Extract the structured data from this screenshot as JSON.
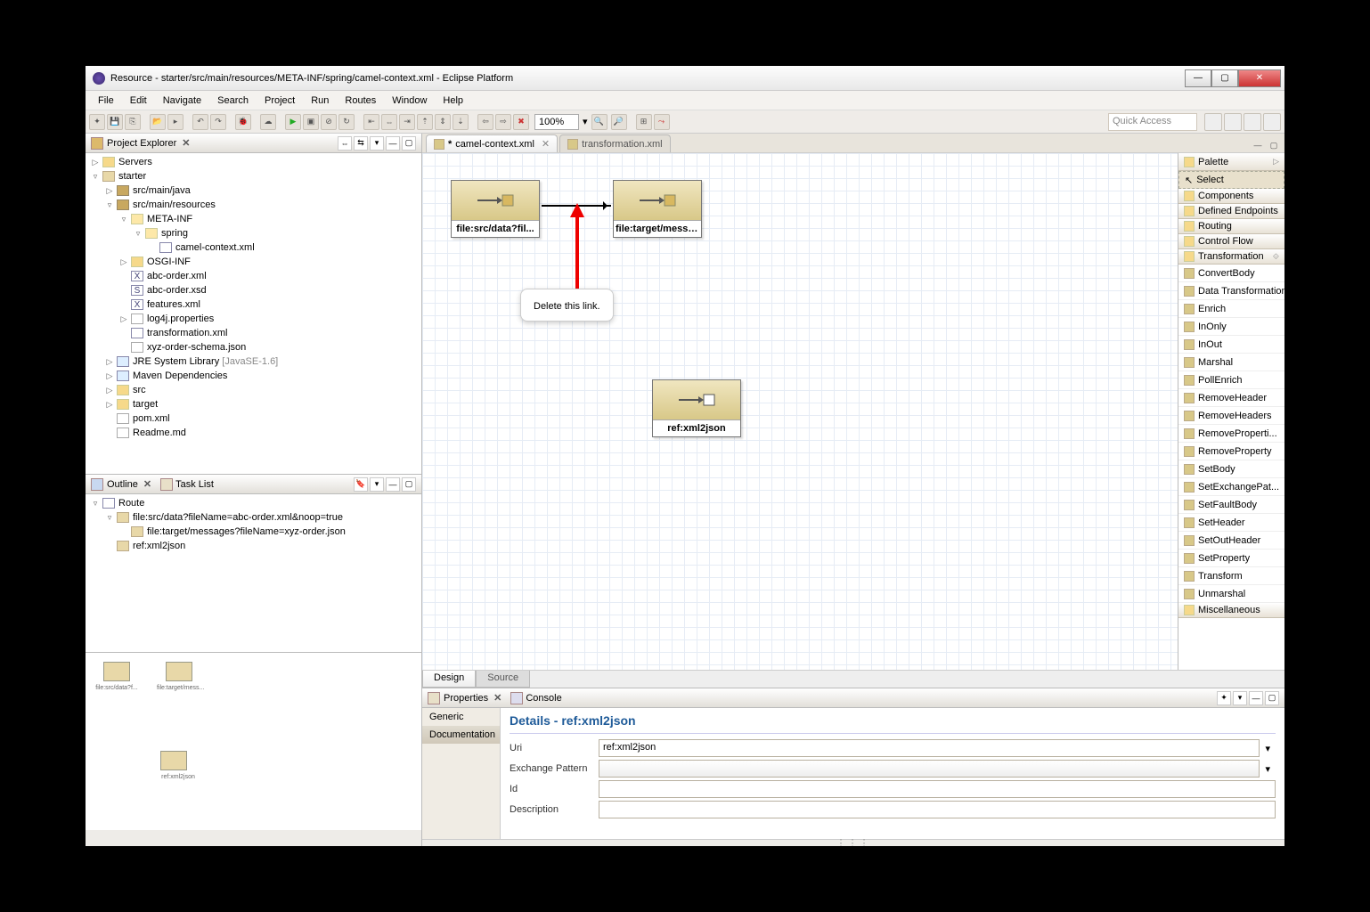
{
  "window": {
    "title": "Resource - starter/src/main/resources/META-INF/spring/camel-context.xml - Eclipse Platform"
  },
  "menus": [
    "File",
    "Edit",
    "Navigate",
    "Search",
    "Project",
    "Run",
    "Routes",
    "Window",
    "Help"
  ],
  "toolbar": {
    "zoom": "100%",
    "quick_access": "Quick Access"
  },
  "projectExplorer": {
    "title": "Project Explorer",
    "tree": {
      "servers": "Servers",
      "starter": "starter",
      "src_java": "src/main/java",
      "src_res": "src/main/resources",
      "meta_inf": "META-INF",
      "spring": "spring",
      "camel_ctx": "camel-context.xml",
      "osgi_inf": "OSGI-INF",
      "abc_xml": "abc-order.xml",
      "abc_xsd": "abc-order.xsd",
      "features": "features.xml",
      "log4j": "log4j.properties",
      "transformation": "transformation.xml",
      "xyz_schema": "xyz-order-schema.json",
      "jre": "JRE System Library",
      "jre_ver": "[JavaSE-1.6]",
      "maven": "Maven Dependencies",
      "src": "src",
      "target": "target",
      "pom": "pom.xml",
      "readme": "Readme.md"
    }
  },
  "outline": {
    "title": "Outline",
    "task_list": "Task List",
    "route": "Route",
    "item1": "file:src/data?fileName=abc-order.xml&noop=true",
    "item2": "file:target/messages?fileName=xyz-order.json",
    "item3": "ref:xml2json"
  },
  "editor": {
    "tab1": "camel-context.xml",
    "tab1_dirty": "*",
    "tab2": "transformation.xml",
    "node1": "file:src/data?fil...",
    "node2": "file:target/messa...",
    "node3": "ref:xml2json",
    "callout": "Delete this link.",
    "design_tab": "Design",
    "source_tab": "Source"
  },
  "palette": {
    "title": "Palette",
    "select": "Select",
    "sections": {
      "components": "Components",
      "endpoints": "Defined Endpoints",
      "routing": "Routing",
      "control": "Control Flow",
      "transformation": "Transformation",
      "misc": "Miscellaneous"
    },
    "transforms": [
      "ConvertBody",
      "Data Transformation",
      "Enrich",
      "InOnly",
      "InOut",
      "Marshal",
      "PollEnrich",
      "RemoveHeader",
      "RemoveHeaders",
      "RemoveProperti...",
      "RemoveProperty",
      "SetBody",
      "SetExchangePat...",
      "SetFaultBody",
      "SetHeader",
      "SetOutHeader",
      "SetProperty",
      "Transform",
      "Unmarshal"
    ]
  },
  "properties": {
    "title": "Properties",
    "console": "Console",
    "generic": "Generic",
    "documentation": "Documentation",
    "details_hdr": "Details - ref:xml2json",
    "uri_label": "Uri",
    "uri_value": "ref:xml2json",
    "exch_label": "Exchange Pattern",
    "id_label": "Id",
    "desc_label": "Description"
  },
  "thumbs": {
    "t1": "file:src/data?f...",
    "t2": "file:target/mess...",
    "t3": "ref:xml2json"
  }
}
